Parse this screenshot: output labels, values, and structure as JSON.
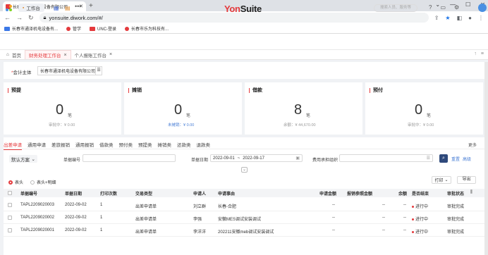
{
  "browser": {
    "tab_title": "长春市通泽机电设备有限公司",
    "url": "yonsuite.diwork.com/#/",
    "bookmarks": [
      "长春市通泽机电设备有...",
      "管学",
      "UNC-登录",
      "长春市乐为科技有..."
    ]
  },
  "app": {
    "workbench_label": "工作台",
    "logo_part1": "Yon",
    "logo_part2": "Suite",
    "search_placeholder": "搜索人员、服务等"
  },
  "page_tabs": [
    {
      "label": "首页"
    },
    {
      "label": "财务处理工作台"
    },
    {
      "label": "个人报账工作台"
    }
  ],
  "org": {
    "label": "会计主体",
    "value": "长春市通泽机电设备有限公司"
  },
  "cards": [
    {
      "title": "预提",
      "number": "0",
      "unit": "笔",
      "sub_label": "审批中：",
      "sub_value": "¥ 0.00"
    },
    {
      "title": "摊销",
      "number": "0",
      "unit": "笔",
      "sub_label": "未摊销：",
      "sub_value": "¥ 0.00"
    },
    {
      "title": "借款",
      "number": "8",
      "unit": "笔",
      "sub_label": "余额：",
      "sub_value": "¥ 44,670.00"
    },
    {
      "title": "预付",
      "number": "0",
      "unit": "笔",
      "sub_label": "审批中：",
      "sub_value": "¥ 0.00"
    }
  ],
  "list_tabs": [
    "出差申请",
    "通用申请",
    "差旅报销",
    "通用报销",
    "借款类",
    "预付类",
    "预提类",
    "摊销类",
    "还款类",
    "退款类"
  ],
  "more_label": "更多",
  "filters": {
    "scheme": "默认方案",
    "doc_no_label": "单据编号",
    "date_label": "单据日期",
    "date_from": "2022-09-01",
    "date_sep": "~",
    "date_to": "2022-09-17",
    "dept_label": "费用承担组织",
    "reset_label": "重置",
    "advanced_label": "高级"
  },
  "view_options": {
    "header": "表头",
    "header_detail": "表头+明细"
  },
  "actions": {
    "print": "打印",
    "export": "导出"
  },
  "table": {
    "columns": [
      "单据编号",
      "单据日期",
      "打印次数",
      "交易类型",
      "申请人",
      "申请事由",
      "申请金额",
      "报销参照金额",
      "余额",
      "是否结束",
      "审批状态"
    ],
    "rows": [
      [
        "TAPL2209020003",
        "2022-09-02",
        "1",
        "出差申请单",
        "刘立群",
        "长春-合肥",
        "--",
        "--",
        "--",
        "进行中",
        "审批完成"
      ],
      [
        "TAPL2209020002",
        "2022-09-02",
        "1",
        "出差申请单",
        "李强",
        "安徽MES调试安装调试",
        "--",
        "--",
        "--",
        "进行中",
        "审批完成"
      ],
      [
        "TAPL2209020001",
        "2022-09-02",
        "1",
        "出差申请单",
        "李洋洋",
        "202211安徽meb调试安装调试",
        "--",
        "--",
        "--",
        "进行中",
        "审批完成"
      ]
    ]
  },
  "colors": {
    "accent": "#e4393c",
    "link": "#4a7fd6",
    "search_btn": "#2f4a7c"
  }
}
